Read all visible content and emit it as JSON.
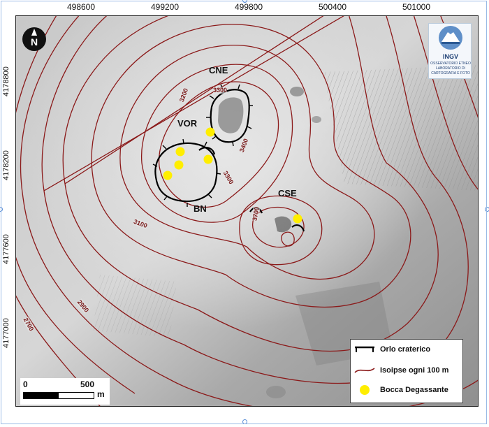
{
  "map": {
    "x_ticks": [
      "498600",
      "499200",
      "499800",
      "500400",
      "501000"
    ],
    "y_ticks": [
      "4178800",
      "4178200",
      "4177600",
      "4177000"
    ],
    "craters": {
      "cne": "CNE",
      "vor": "VOR",
      "bn": "BN",
      "cse": "CSE"
    },
    "contour_labels": [
      "3300",
      "3200",
      "3400",
      "3300",
      "3100",
      "3700",
      "2900",
      "2700"
    ],
    "colors": {
      "contour": "#8b1a1a",
      "rim": "#000000",
      "vent": "#ffee00",
      "relief_bg": "#b7b7b7"
    }
  },
  "legend": {
    "rim_label": "Orlo craterico",
    "contour_label": "Isoipse ogni 100 m",
    "vent_label": "Bocca Degassante"
  },
  "scale_bar": {
    "start": "0",
    "end": "500",
    "unit": "m"
  },
  "logo": {
    "acronym": "INGV",
    "line1": "OSSERVATORIO ETNEO",
    "line2": "LABORATORIO DI",
    "line3": "CARTOGRAFIA E FOTO"
  },
  "north_arrow": {
    "letter": "N"
  }
}
